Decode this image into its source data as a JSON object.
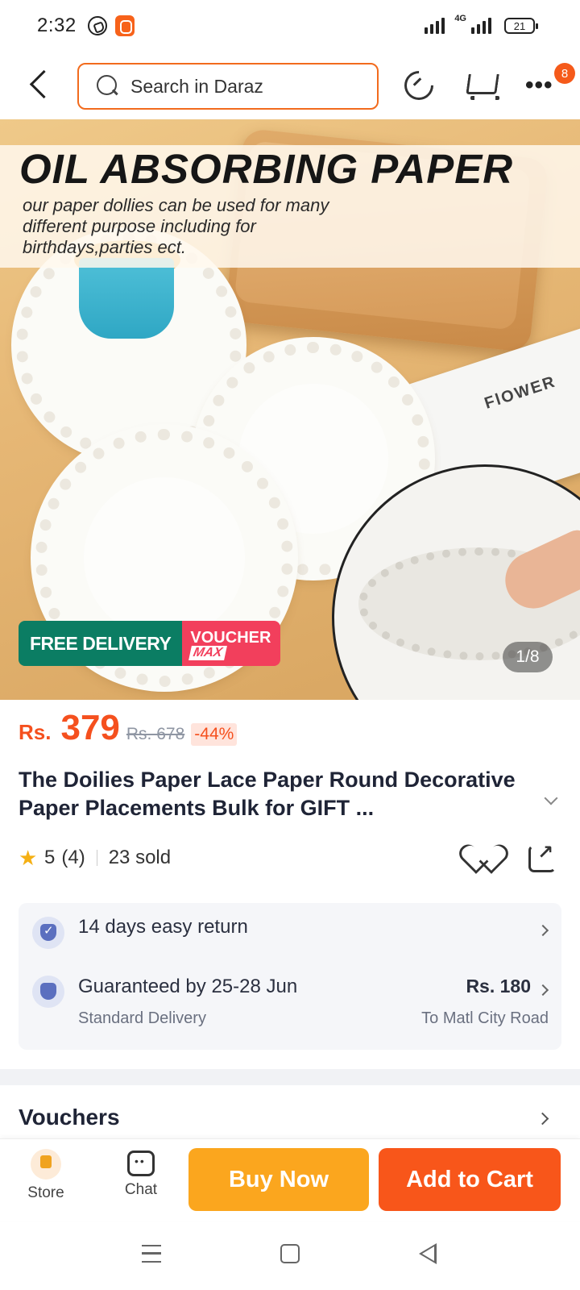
{
  "status_bar": {
    "time": "2:32",
    "network": "4G",
    "battery": "21",
    "icons": [
      "whatsapp-icon",
      "app-notification-icon",
      "signal-icon",
      "battery-icon"
    ]
  },
  "header": {
    "search_placeholder": "Search in Daraz",
    "notification_count": "8",
    "accent_color": "#f26b1d"
  },
  "hero": {
    "title": "OIL ABSORBING PAPER",
    "subtitle": "our paper dollies can be used for many different purpose including for birthdays,parties ect.",
    "card_text": "FlOWER",
    "free_delivery": "FREE DELIVERY",
    "voucher_line1": "VOUCHER",
    "voucher_line2": "MAX",
    "image_counter": "1/8"
  },
  "product": {
    "currency": "Rs.",
    "price": "379",
    "original_price": "Rs. 678",
    "discount": "-44%",
    "title": "The Doilies Paper Lace Paper Round Decorative Paper Placements Bulk for GIFT ...",
    "rating": "5",
    "reviews": "(4)",
    "sold": "23 sold",
    "price_color": "#f5501e"
  },
  "delivery": {
    "return_text": "14 days easy return",
    "guarantee_text": "Guaranteed by 25-28 Jun",
    "delivery_type": "Standard Delivery",
    "delivery_fee": "Rs. 180",
    "destination": "To Matl City Road"
  },
  "vouchers": {
    "title": "Vouchers"
  },
  "bottom_bar": {
    "store_label": "Store",
    "chat_label": "Chat",
    "buy_now_label": "Buy Now",
    "add_to_cart_label": "Add to Cart",
    "buy_color": "#fba61e",
    "cart_color": "#f8561a"
  }
}
